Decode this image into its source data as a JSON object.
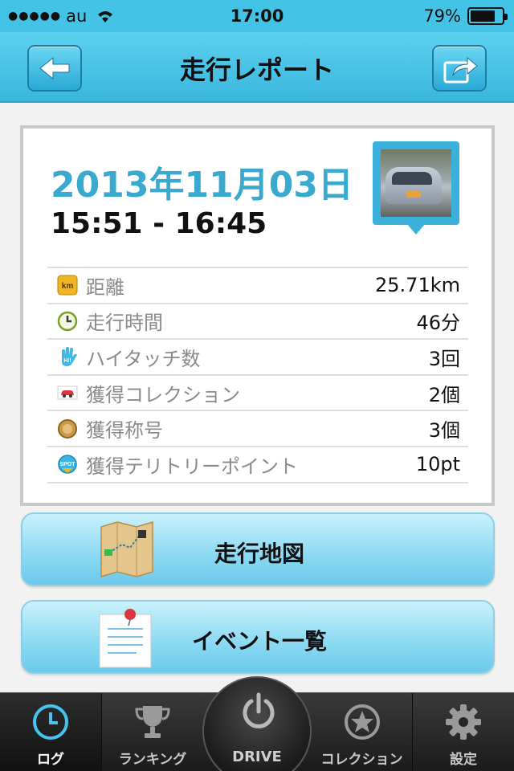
{
  "status": {
    "carrier": "au",
    "signal_dots": "●●●●●",
    "time": "17:00",
    "battery_text": "79%",
    "battery_level": 0.79
  },
  "nav": {
    "title": "走行レポート",
    "back_icon": "back-arrow-icon",
    "share_icon": "share-arrow-icon"
  },
  "report": {
    "date": "2013年11月03日",
    "time_range": "15:51 - 16:45",
    "stats": [
      {
        "icon": "km-icon",
        "label": "距離",
        "value": "25.71km"
      },
      {
        "icon": "clock-icon",
        "label": "走行時間",
        "value": "46分"
      },
      {
        "icon": "hi-hand-icon",
        "label": "ハイタッチ数",
        "value": "3回"
      },
      {
        "icon": "car-icon",
        "label": "獲得コレクション",
        "value": "2個"
      },
      {
        "icon": "medal-icon",
        "label": "獲得称号",
        "value": "3個"
      },
      {
        "icon": "spot-icon",
        "label": "獲得テリトリーポイント",
        "value": "10pt"
      }
    ]
  },
  "buttons": {
    "map": "走行地図",
    "events": "イベント一覧"
  },
  "tabs": [
    {
      "label": "ログ",
      "icon": "clock-icon"
    },
    {
      "label": "ランキング",
      "icon": "trophy-icon"
    },
    {
      "label": "DRIVE",
      "icon": "power-icon"
    },
    {
      "label": "コレクション",
      "icon": "star-icon"
    },
    {
      "label": "設定",
      "icon": "gear-icon"
    }
  ],
  "colors": {
    "accent": "#3bb8e0",
    "date": "#3aa9cf",
    "tabbar": "#2a2a2a"
  }
}
